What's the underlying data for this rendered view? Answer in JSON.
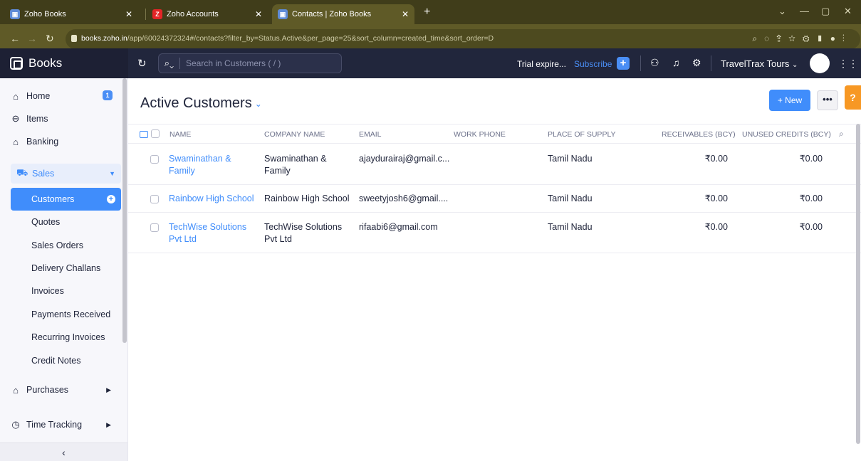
{
  "browser": {
    "tabs": [
      {
        "title": "Zoho Books",
        "icon": "zoho-books-favicon"
      },
      {
        "title": "Zoho Accounts",
        "icon": "zoho-z-favicon"
      },
      {
        "title": "Contacts | Zoho Books",
        "icon": "zoho-books-favicon"
      }
    ],
    "url_host": "books.zoho.in",
    "url_path": "/app/60024372324#/contacts?filter_by=Status.Active&per_page=25&sort_column=created_time&sort_order=D"
  },
  "header": {
    "brand": "Books",
    "search_placeholder": "Search in Customers ( / )",
    "trial_text": "Trial expire...",
    "subscribe_label": "Subscribe",
    "org_name": "TravelTrax Tours",
    "org_chevron": "⌄"
  },
  "sidebar": {
    "home": {
      "label": "Home",
      "badge": "1"
    },
    "items": {
      "label": "Items"
    },
    "banking": {
      "label": "Banking"
    },
    "sales": {
      "label": "Sales"
    },
    "sales_sub": [
      "Customers",
      "Quotes",
      "Sales Orders",
      "Delivery Challans",
      "Invoices",
      "Payments Received",
      "Recurring Invoices",
      "Credit Notes"
    ],
    "purchases": {
      "label": "Purchases"
    },
    "time_tracking": {
      "label": "Time Tracking"
    },
    "collapse_glyph": "‹"
  },
  "main": {
    "title": "Active Customers",
    "new_label": "+ New",
    "more_label": "•••",
    "help_label": "?",
    "columns": [
      "NAME",
      "COMPANY NAME",
      "EMAIL",
      "WORK PHONE",
      "PLACE OF SUPPLY",
      "RECEIVABLES (BCY)",
      "UNUSED CREDITS (BCY)"
    ],
    "rows": [
      {
        "name_l1": "Swaminathan &",
        "name_l2": "Family",
        "company_l1": "Swaminathan &",
        "company_l2": "Family",
        "email": "ajaydurairaj@gmail.c...",
        "work_phone": "",
        "place": "Tamil Nadu",
        "receivables": "₹0.00",
        "credits": "₹0.00"
      },
      {
        "name_l1": "Rainbow High School",
        "name_l2": "",
        "company_l1": "Rainbow High School",
        "company_l2": "",
        "email": "sweetyjosh6@gmail....",
        "work_phone": "",
        "place": "Tamil Nadu",
        "receivables": "₹0.00",
        "credits": "₹0.00"
      },
      {
        "name_l1": "TechWise Solutions",
        "name_l2": "Pvt Ltd",
        "company_l1": "TechWise Solutions",
        "company_l2": "Pvt Ltd",
        "email": "rifaabi6@gmail.com",
        "work_phone": "",
        "place": "Tamil Nadu",
        "receivables": "₹0.00",
        "credits": "₹0.00"
      }
    ]
  },
  "colors": {
    "accent": "#408dfb",
    "header_bg": "#21263c",
    "browser_bg": "#403d1a",
    "help": "#f79824"
  }
}
